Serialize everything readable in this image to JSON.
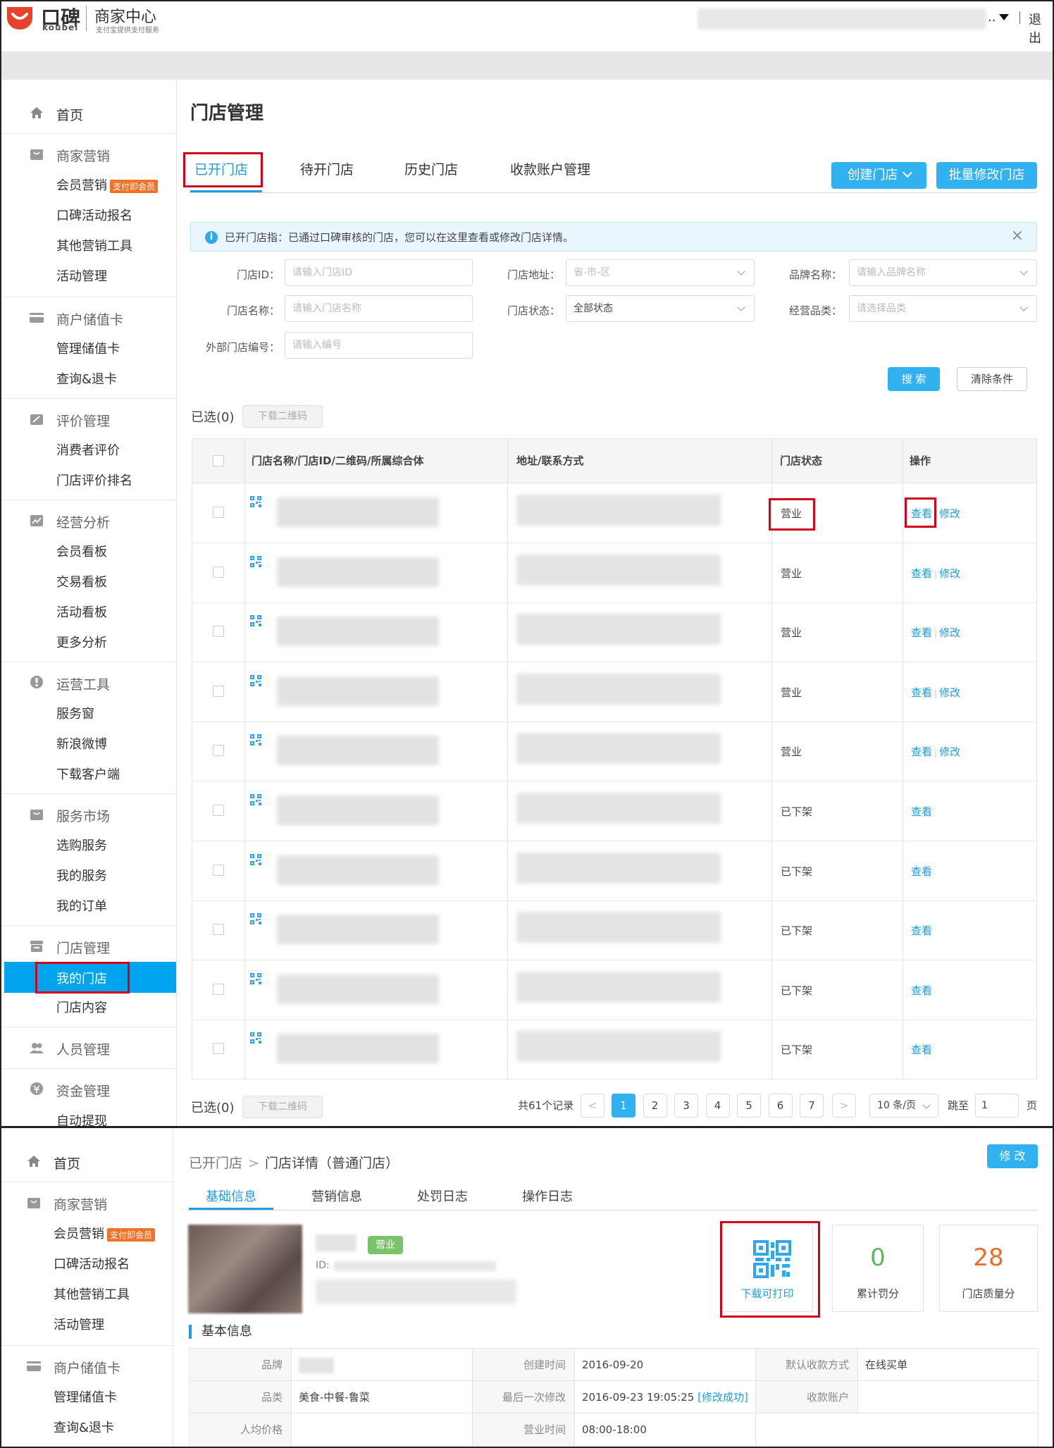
{
  "header": {
    "logo_text": "口碑",
    "logo_sub": "koubei",
    "title": "商家中心",
    "subtitle": "支付宝提供支付服务",
    "dots": "..",
    "logout": "退出"
  },
  "sidebar": {
    "home": "首页",
    "groups": [
      {
        "label": "商家营销",
        "icon": "bag-icon",
        "items": [
          "会员营销",
          "口碑活动报名",
          "其他营销工具",
          "活动管理"
        ],
        "badge": "支付即会员"
      },
      {
        "label": "商户储值卡",
        "icon": "card-icon",
        "items": [
          "管理储值卡",
          "查询&退卡"
        ]
      },
      {
        "label": "评价管理",
        "icon": "edit-icon",
        "items": [
          "消费者评价",
          "门店评价排名"
        ]
      },
      {
        "label": "经营分析",
        "icon": "chart-icon",
        "items": [
          "会员看板",
          "交易看板",
          "活动看板",
          "更多分析"
        ]
      },
      {
        "label": "运营工具",
        "icon": "tools-icon",
        "items": [
          "服务窗",
          "新浪微博",
          "下载客户端"
        ]
      },
      {
        "label": "服务市场",
        "icon": "shop-icon",
        "items": [
          "选购服务",
          "我的服务",
          "我的订单"
        ]
      },
      {
        "label": "门店管理",
        "icon": "store-icon",
        "items": [
          "我的门店",
          "门店内容"
        ]
      },
      {
        "label": "人员管理",
        "icon": "people-icon",
        "items": []
      },
      {
        "label": "资金管理",
        "icon": "money-icon",
        "items": [
          "自动提现"
        ]
      }
    ]
  },
  "main": {
    "title": "门店管理",
    "tabs": [
      "已开门店",
      "待开门店",
      "历史门店",
      "收款账户管理"
    ],
    "create_btn": "创建门店",
    "batch_btn": "批量修改门店",
    "notice": "已开门店指：已通过口碑审核的门店，您可以在这里查看或修改门店详情。",
    "filters": {
      "store_id_label": "门店ID：",
      "store_id_ph": "请输入门店ID",
      "addr_label": "门店地址：",
      "addr_ph": "省-市-区",
      "brand_label": "品牌名称：",
      "brand_ph": "请输入品牌名称",
      "name_label": "门店名称：",
      "name_ph": "请输入门店名称",
      "status_label": "门店状态：",
      "status_val": "全部状态",
      "cat_label": "经营品类：",
      "cat_ph": "请选择品类",
      "ext_label": "外部门店编号：",
      "ext_ph": "请输入编号"
    },
    "search_btn": "搜 索",
    "clear_btn": "清除条件",
    "selected": "已选(0)",
    "download_qr": "下载二维码",
    "table": {
      "headers": [
        "门店名称/门店ID/二维码/所属综合体",
        "地址/联系方式",
        "门店状态",
        "操作"
      ],
      "rows": [
        {
          "status": "营业",
          "view": "查看",
          "edit": "修改"
        },
        {
          "status": "营业",
          "view": "查看",
          "edit": "修改"
        },
        {
          "status": "营业",
          "view": "查看",
          "edit": "修改"
        },
        {
          "status": "营业",
          "view": "查看",
          "edit": "修改"
        },
        {
          "status": "营业",
          "view": "查看",
          "edit": "修改"
        },
        {
          "status": "已下架",
          "view": "查看",
          "edit": ""
        },
        {
          "status": "已下架",
          "view": "查看",
          "edit": ""
        },
        {
          "status": "已下架",
          "view": "查看",
          "edit": ""
        },
        {
          "status": "已下架",
          "view": "查看",
          "edit": ""
        },
        {
          "status": "已下架",
          "view": "查看",
          "edit": ""
        }
      ]
    },
    "pagination": {
      "total": "共61个记录",
      "pages": [
        "1",
        "2",
        "3",
        "4",
        "5",
        "6",
        "7"
      ],
      "current": "1",
      "prev": "<",
      "next": ">",
      "per_page": "10 条/页",
      "jump_label": "跳至",
      "jump_val": "1",
      "page_suffix": "页"
    }
  },
  "detail": {
    "crumb_parent": "已开门店",
    "crumb_sep": ">",
    "crumb_current": "门店详情（普通门店）",
    "edit_btn": "修 改",
    "tabs": [
      "基础信息",
      "营销信息",
      "处罚日志",
      "操作日志"
    ],
    "status_badge": "营业",
    "id_label": "ID:",
    "cards": [
      {
        "label": "下载可打印",
        "value": ""
      },
      {
        "label": "累计罚分",
        "value": "0",
        "color": "#5cb85c"
      },
      {
        "label": "门店质量分",
        "value": "28",
        "color": "#e8702a"
      }
    ],
    "section_title": "基本信息",
    "info": {
      "brand_label": "品牌",
      "created_label": "创建时间",
      "created_val": "2016-09-20",
      "pay_label": "默认收款方式",
      "pay_val": "在线买单",
      "cat_label": "品类",
      "cat_val": "美食-中餐-鲁菜",
      "modified_label": "最后一次修改",
      "modified_val": "2016-09-23 19:05:25",
      "modified_status": "[修改成功]",
      "account_label": "收款账户",
      "avg_label": "人均价格",
      "hours_label": "营业时间",
      "hours_val": "08:00-18:00"
    }
  }
}
